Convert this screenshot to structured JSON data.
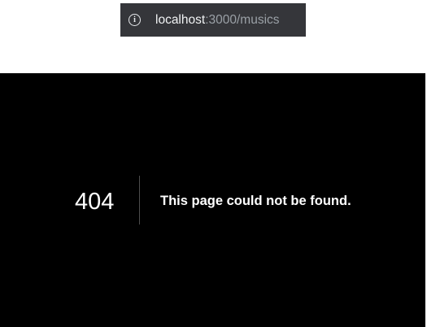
{
  "browser": {
    "address_bar": {
      "icon": "info-icon",
      "host": "localhost",
      "path": ":3000/musics"
    }
  },
  "error_page": {
    "code": "404",
    "message": "This page could not be found."
  }
}
